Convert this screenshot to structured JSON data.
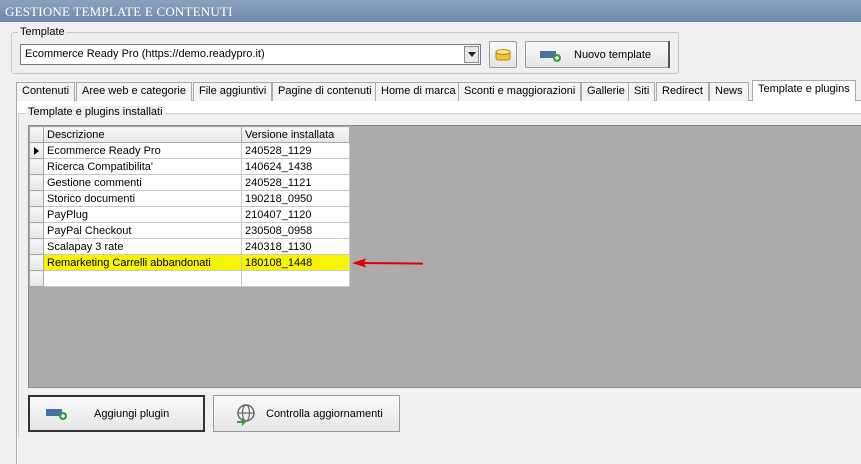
{
  "window": {
    "title": "GESTIONE TEMPLATE E CONTENUTI"
  },
  "template": {
    "group_label": "Template",
    "selected": "Ecommerce Ready Pro (https://demo.readypro.it)",
    "new_button": "Nuovo template"
  },
  "tabs": [
    {
      "label": "Contenuti"
    },
    {
      "label": "Aree web e categorie"
    },
    {
      "label": "File aggiuntivi"
    },
    {
      "label": "Pagine di contenuti"
    },
    {
      "label": "Home di marca"
    },
    {
      "label": "Sconti e maggiorazioni"
    },
    {
      "label": "Gallerie"
    },
    {
      "label": "Siti"
    },
    {
      "label": "Redirect"
    },
    {
      "label": "News"
    },
    {
      "label": "Template e plugins"
    }
  ],
  "plugins": {
    "group_label": "Template e plugins installati",
    "columns": {
      "description": "Descrizione",
      "version": "Versione installata"
    },
    "rows": [
      {
        "description": "Ecommerce Ready Pro",
        "version": "240528_1129"
      },
      {
        "description": "Ricerca Compatibilita'",
        "version": "140624_1438"
      },
      {
        "description": "Gestione commenti",
        "version": "240528_1121"
      },
      {
        "description": "Storico documenti",
        "version": "190218_0950"
      },
      {
        "description": "PayPlug",
        "version": "210407_1120"
      },
      {
        "description": "PayPal Checkout",
        "version": "230508_0958"
      },
      {
        "description": "Scalapay 3 rate",
        "version": "240318_1130"
      },
      {
        "description": "Remarketing Carrelli abbandonati",
        "version": "180108_1448"
      }
    ],
    "add_button": "Aggiungi plugin",
    "check_button": "Controlla aggiornamenti"
  },
  "colors": {
    "highlight": "#f7f500",
    "arrow": "#e00000"
  }
}
